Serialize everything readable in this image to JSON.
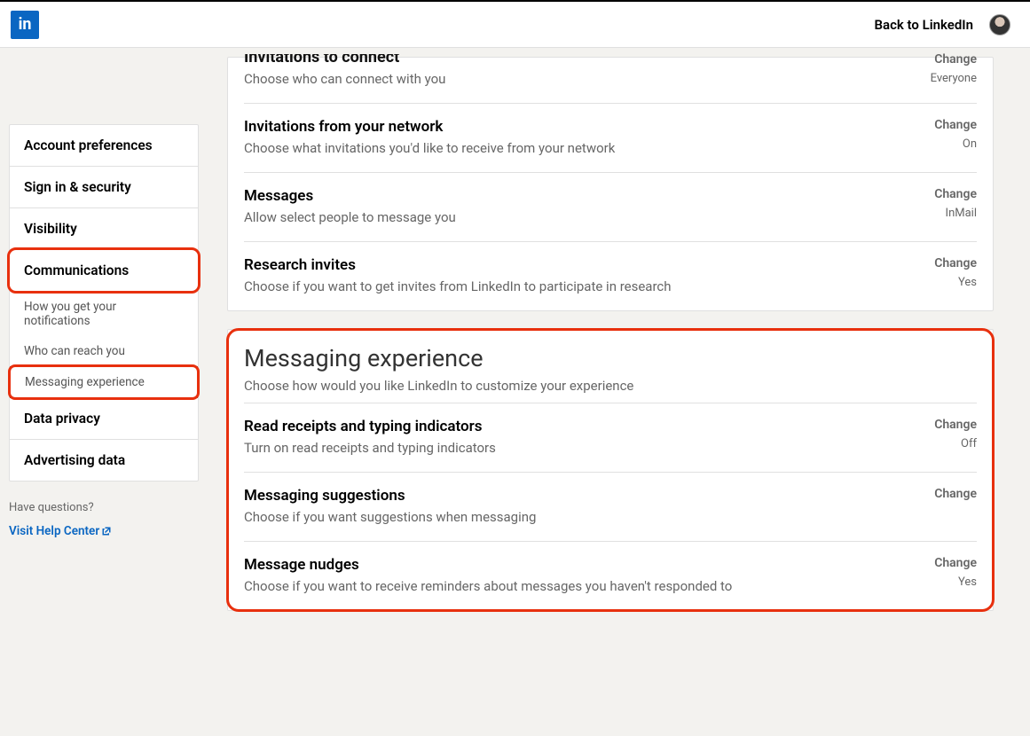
{
  "topbar": {
    "logo_text": "in",
    "back_label": "Back to LinkedIn"
  },
  "sidebar": {
    "items": [
      {
        "label": "Account preferences"
      },
      {
        "label": "Sign in & security"
      },
      {
        "label": "Visibility"
      },
      {
        "label": "Communications",
        "active": true,
        "highlighted": true,
        "subitems": [
          {
            "label": "How you get your notifications"
          },
          {
            "label": "Who can reach you"
          },
          {
            "label": "Messaging experience",
            "selected": true
          }
        ]
      },
      {
        "label": "Data privacy"
      },
      {
        "label": "Advertising data"
      }
    ],
    "help_question": "Have questions?",
    "help_link": "Visit Help Center"
  },
  "main": {
    "reach_section": {
      "partial_title": "Invitations to connect",
      "settings": [
        {
          "title": "",
          "desc": "Choose who can connect with you",
          "change": "Change",
          "value": "Everyone",
          "partial": true
        },
        {
          "title": "Invitations from your network",
          "desc": "Choose what invitations you'd like to receive from your network",
          "change": "Change",
          "value": "On"
        },
        {
          "title": "Messages",
          "desc": "Allow select people to message you",
          "change": "Change",
          "value": "InMail"
        },
        {
          "title": "Research invites",
          "desc": "Choose if you want to get invites from LinkedIn to participate in research",
          "change": "Change",
          "value": "Yes"
        }
      ]
    },
    "messaging_section": {
      "title": "Messaging experience",
      "subtitle": "Choose how would you like LinkedIn to customize your experience",
      "settings": [
        {
          "title": "Read receipts and typing indicators",
          "desc": "Turn on read receipts and typing indicators",
          "change": "Change",
          "value": "Off"
        },
        {
          "title": "Messaging suggestions",
          "desc": "Choose if you want suggestions when messaging",
          "change": "Change",
          "value": ""
        },
        {
          "title": "Message nudges",
          "desc": "Choose if you want to receive reminders about messages you haven't responded to",
          "change": "Change",
          "value": "Yes"
        }
      ]
    }
  }
}
